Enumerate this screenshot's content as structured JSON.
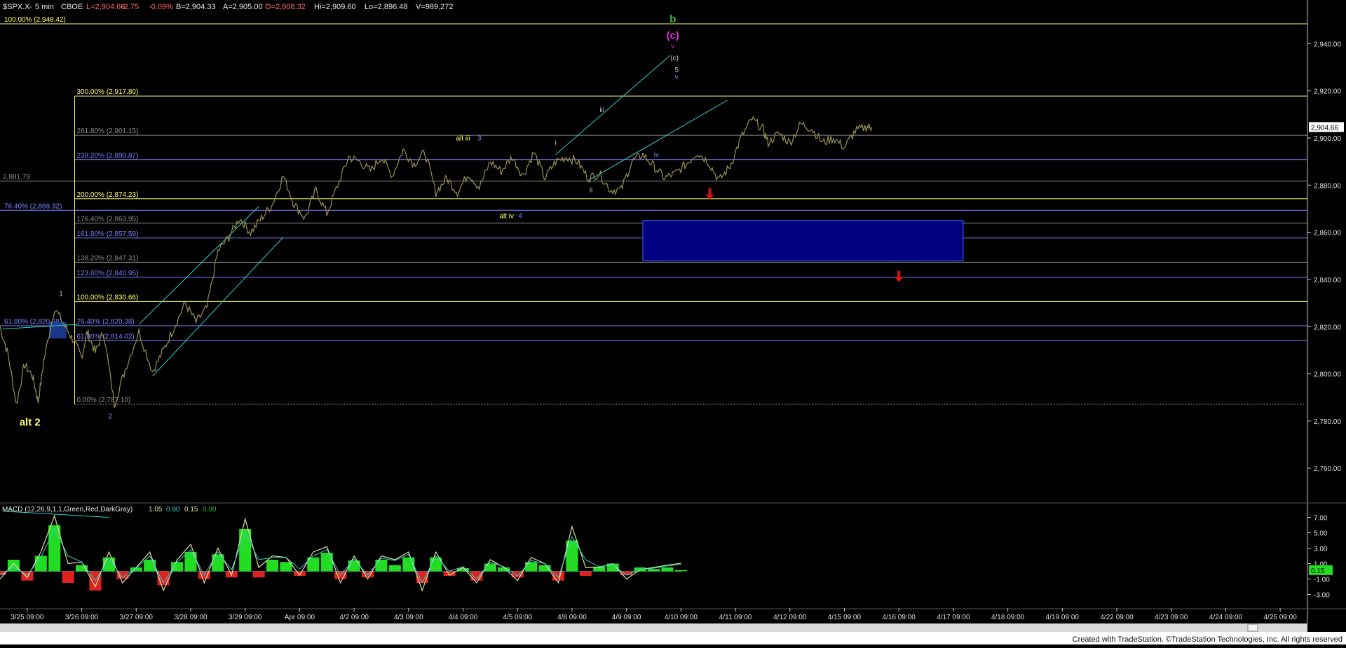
{
  "header": {
    "symbol": "$SPX.X",
    "interval": "5 min",
    "exchange": "CBOE",
    "last": "L=2,904.66",
    "change": "-2.75",
    "change_pct": "-0.09%",
    "bid": "B=2,904.33",
    "ask": "A=2,905.00",
    "open": "O=2,908.32",
    "high": "Hi=2,909.60",
    "low": "Lo=2,896.48",
    "volume": "V=989,272"
  },
  "colors": {
    "background": "#000000",
    "axis": "#c8c8c8",
    "yellow": "#ffff66",
    "blue": "#7f7fff",
    "gray": "#8a8a8a",
    "cyan": "#33cccc",
    "green_label": "#2fbf2f",
    "magenta": "#dd33dd",
    "target_box": "#000080",
    "arrow_red": "#dd1111",
    "macd_green": "#22dd22",
    "macd_red": "#dd2222",
    "macd_line": "#e0e0a0",
    "macd_signal": "#33cccc"
  },
  "footer": {
    "credit": "Created with TradeStation. ©TradeStation Technologies, Inc. All rights reserved"
  },
  "macd_header": {
    "label": "MACD (12,26,9,1,1,Green,Red,DarkGray)",
    "v1": "1.05",
    "v2": "0.90",
    "v3": "0.15",
    "v4": "0.00"
  },
  "chart_data": [
    {
      "type": "line",
      "title": "$SPX.X - 5 min CBOE",
      "ylim": [
        2747,
        2952
      ],
      "x_tick_labels": [
        "3/25 09:00",
        "3/26 09:00",
        "3/27 09:00",
        "3/28 09:00",
        "3/29 09:00",
        "Apr 09:00",
        "4/2 09:00",
        "4/3 09:00",
        "4/4 09:00",
        "4/5 09:00",
        "4/8 09:00",
        "4/9 09:00",
        "4/10 09:00",
        "4/11 09:00",
        "4/12 09:00",
        "4/15 09:00",
        "4/16 09:00",
        "4/17 09:00",
        "4/18 09:00",
        "4/19 09:00",
        "4/22 09:00",
        "4/23 09:00",
        "4/24 09:00",
        "4/25 09:00"
      ],
      "x_tick_positions": [
        0.5,
        1.5,
        2.5,
        3.5,
        4.5,
        5.5,
        6.5,
        7.5,
        8.5,
        9.5,
        10.5,
        11.5,
        12.5,
        13.5,
        14.5,
        15.5,
        16.5,
        17.5,
        18.5,
        19.5,
        20.5,
        21.5,
        22.5,
        23.5
      ],
      "y_ticks": [
        2760,
        2780,
        2800,
        2820,
        2840,
        2860,
        2880,
        2900,
        2920,
        2940
      ],
      "y_tick_labels": [
        "2,760.00",
        "2,780.00",
        "2,800.00",
        "2,820.00",
        "2,840.00",
        "2,860.00",
        "2,880.00",
        "2,900.00",
        "2,920.00",
        "2,940.00"
      ],
      "last_price_label": "2,904.66",
      "last_price": 2904.66,
      "series": [
        {
          "values_x": [
            0,
            0.15,
            0.3,
            0.45,
            0.6,
            0.7,
            0.8,
            1.0,
            1.2,
            1.35,
            1.5,
            1.6,
            1.75,
            1.9,
            2.1,
            2.3,
            2.55,
            2.8,
            3.0,
            3.2,
            3.4,
            3.6,
            3.8,
            4.0,
            4.2,
            4.4,
            4.6,
            4.8,
            5.0,
            5.2,
            5.4,
            5.6,
            5.8,
            6.0,
            6.2,
            6.4,
            6.6,
            6.8,
            7.0,
            7.2,
            7.4,
            7.6,
            7.8,
            8.0,
            8.2,
            8.4,
            8.6,
            8.8,
            9.0,
            9.2,
            9.4,
            9.6,
            9.8,
            10.0,
            10.2,
            10.4,
            10.6,
            10.8,
            11.0,
            11.2,
            11.4,
            11.6,
            11.8,
            12.0,
            12.2,
            12.4,
            12.6,
            12.8,
            13.0,
            13.2,
            13.4,
            13.6,
            13.8,
            14.0,
            14.1,
            14.3,
            14.5,
            14.7,
            14.9,
            15.1,
            15.3,
            15.5,
            15.7,
            15.9,
            16.0
          ],
          "values": [
            2820,
            2808,
            2787,
            2804,
            2799,
            2788,
            2805,
            2828,
            2820,
            2814,
            2807,
            2818,
            2809,
            2818,
            2787,
            2802,
            2818,
            2801,
            2810,
            2820,
            2830,
            2822,
            2828,
            2852,
            2858,
            2866,
            2860,
            2866,
            2872,
            2884,
            2872,
            2866,
            2878,
            2868,
            2880,
            2892,
            2890,
            2886,
            2892,
            2884,
            2895,
            2889,
            2894,
            2877,
            2883,
            2877,
            2885,
            2879,
            2890,
            2886,
            2892,
            2884,
            2894,
            2883,
            2890,
            2892,
            2890,
            2883,
            2885,
            2878,
            2878,
            2890,
            2893,
            2888,
            2883,
            2885,
            2889,
            2894,
            2890,
            2882,
            2888,
            2900,
            2908,
            2904,
            2898,
            2902,
            2898,
            2906,
            2904,
            2898,
            2900,
            2896,
            2903,
            2904.66,
            2904.66
          ]
        }
      ],
      "fib_levels": [
        {
          "label": "100.00% (2,948.42)",
          "value": 2948.42,
          "color": "yellow"
        },
        {
          "label": "300.00% (2,917.80)",
          "value": 2917.8,
          "color": "yellow"
        },
        {
          "label": "261.80% (2,901.15)",
          "value": 2901.15,
          "color": "gray"
        },
        {
          "label": "238.20% (2,890.87)",
          "value": 2890.87,
          "color": "blue"
        },
        {
          "label": "2,881.79",
          "value": 2881.79,
          "color": "gray"
        },
        {
          "label": "200.00% (2,874.23)",
          "value": 2874.23,
          "color": "yellow"
        },
        {
          "label": "76.40% (2,869.32)",
          "value": 2869.32,
          "color": "blue"
        },
        {
          "label": "176.40% (2,863.95)",
          "value": 2863.95,
          "color": "gray"
        },
        {
          "label": "161.80% (2,857.59)",
          "value": 2857.59,
          "color": "blue"
        },
        {
          "label": "138.20% (2,847.31)",
          "value": 2847.31,
          "color": "gray"
        },
        {
          "label": "123.60% (2,840.95)",
          "value": 2840.95,
          "color": "blue"
        },
        {
          "label": "100.00% (2,830.66)",
          "value": 2830.66,
          "color": "yellow"
        },
        {
          "label": "76.40% (2,820.38)",
          "value": 2820.38,
          "color": "blue"
        },
        {
          "label": "61.80% (2,820.38)",
          "value": 2820.38,
          "color": "blue"
        },
        {
          "label": "61.80% (2,814.02)",
          "value": 2814.02,
          "color": "blue"
        },
        {
          "label": "0.00% (2,787.10)",
          "value": 2787.1,
          "color": "gray"
        }
      ],
      "wave_labels": [
        {
          "text": "b",
          "x": 12.35,
          "y": 2949,
          "color": "green_label"
        },
        {
          "text": "(c)",
          "x": 12.35,
          "y": 2942,
          "color": "magenta"
        },
        {
          "text": "v",
          "x": 12.35,
          "y": 2938,
          "color": "magenta"
        },
        {
          "text": "(c)",
          "x": 12.38,
          "y": 2933,
          "color": "axis"
        },
        {
          "text": "5",
          "x": 12.42,
          "y": 2928,
          "color": "axis"
        },
        {
          "text": "v",
          "x": 12.42,
          "y": 2925,
          "color": "blue"
        },
        {
          "text": "iii",
          "x": 11.05,
          "y": 2911,
          "color": "axis"
        },
        {
          "text": "i",
          "x": 10.2,
          "y": 2897,
          "color": "axis"
        },
        {
          "text": "iv",
          "x": 12.05,
          "y": 2892,
          "color": "blue"
        },
        {
          "text": "ii",
          "x": 10.85,
          "y": 2877,
          "color": "axis"
        },
        {
          "text": "alt iii",
          "x": 8.5,
          "y": 2899,
          "color": "yellow"
        },
        {
          "text": "3",
          "x": 8.8,
          "y": 2899,
          "color": "blue"
        },
        {
          "text": "alt iv",
          "x": 9.3,
          "y": 2866,
          "color": "yellow"
        },
        {
          "text": "4",
          "x": 9.55,
          "y": 2866,
          "color": "blue"
        },
        {
          "text": "1",
          "x": 1.12,
          "y": 2833,
          "color": "axis"
        },
        {
          "text": "2",
          "x": 2.02,
          "y": 2781,
          "color": "blue"
        },
        {
          "text": "alt 2",
          "x": 0.55,
          "y": 2778,
          "color": "yellow"
        }
      ],
      "channels": [
        {
          "x1": 2.55,
          "y1": 2821,
          "x2": 4.75,
          "y2": 2871
        },
        {
          "x1": 2.8,
          "y1": 2799,
          "x2": 5.2,
          "y2": 2858
        },
        {
          "x1": 10.2,
          "y1": 2893,
          "x2": 12.3,
          "y2": 2935
        },
        {
          "x1": 10.8,
          "y1": 2882,
          "x2": 13.35,
          "y2": 2916
        },
        {
          "x1": 0.05,
          "y1": 2819,
          "x2": 1.45,
          "y2": 2821
        }
      ],
      "target_box": {
        "x1": 11.8,
        "x2": 17.68,
        "y1": 2848,
        "y2": 2865
      },
      "small_box": {
        "x1": 0.9,
        "x2": 1.22,
        "y1": 2815,
        "y2": 2822
      },
      "arrows": [
        {
          "x": 13.03,
          "y": 2876
        },
        {
          "x": 16.5,
          "y": 2841
        }
      ]
    },
    {
      "type": "area",
      "title": "MACD (12,26,9,1,1,Green,Red,DarkGray)",
      "ylim": [
        -4.5,
        8.5
      ],
      "y_ticks": [
        -3,
        -1,
        1,
        3,
        5,
        7
      ],
      "y_tick_labels": [
        "-3.00",
        "-1.00",
        "1.00",
        "3.00",
        "5.00",
        "7.00"
      ],
      "current_label": "0.15",
      "current_value": 0.15,
      "x": [
        0,
        0.25,
        0.5,
        0.75,
        1.0,
        1.25,
        1.5,
        1.75,
        2.0,
        2.25,
        2.5,
        2.75,
        3.0,
        3.25,
        3.5,
        3.75,
        4.0,
        4.25,
        4.5,
        4.75,
        5.0,
        5.25,
        5.5,
        5.75,
        6.0,
        6.25,
        6.5,
        6.75,
        7.0,
        7.25,
        7.5,
        7.75,
        8.0,
        8.25,
        8.5,
        8.75,
        9.0,
        9.25,
        9.5,
        9.75,
        10.0,
        10.25,
        10.5,
        10.75,
        11.0,
        11.25,
        11.5,
        11.75,
        12.0,
        12.25,
        12.5
      ],
      "histogram": [
        -0.5,
        1.5,
        -1.2,
        2.0,
        6.0,
        -1.5,
        0.8,
        -2.5,
        1.8,
        -1.0,
        0.5,
        1.5,
        -1.8,
        1.2,
        2.5,
        -1.0,
        2.2,
        -0.8,
        5.5,
        -0.8,
        1.5,
        1.2,
        -0.6,
        1.8,
        2.4,
        -1.0,
        1.4,
        -0.8,
        1.5,
        0.8,
        1.8,
        -1.5,
        1.8,
        -0.6,
        0.4,
        -1.2,
        1.0,
        0.5,
        -0.8,
        1.2,
        0.8,
        -1.2,
        4.0,
        -0.6,
        0.6,
        1.0,
        -0.5,
        0.5,
        0.3,
        0.5,
        0.15
      ],
      "macd": [
        -1.0,
        1.0,
        -0.8,
        2.5,
        7.2,
        1.0,
        1.2,
        -2.0,
        2.5,
        -1.5,
        0.5,
        2.5,
        -2.5,
        1.5,
        3.5,
        -1.5,
        3.0,
        -0.5,
        6.8,
        0.5,
        2.0,
        1.8,
        -0.5,
        2.5,
        3.2,
        -1.5,
        2.0,
        -1.0,
        2.0,
        1.5,
        2.5,
        -2.5,
        2.5,
        -0.5,
        0.5,
        -1.5,
        1.5,
        0.5,
        -1.2,
        1.8,
        1.0,
        -1.5,
        5.8,
        0.5,
        0.5,
        1.0,
        -1.0,
        0.2,
        0.5,
        0.8,
        1.05
      ],
      "signal": [
        -0.5,
        0.6,
        -0.5,
        1.8,
        5.5,
        2.0,
        1.2,
        -1.2,
        1.6,
        -0.8,
        0.4,
        2.0,
        -1.5,
        1.2,
        2.8,
        -0.5,
        2.5,
        0.2,
        5.0,
        1.5,
        1.8,
        1.8,
        0.3,
        2.0,
        2.8,
        -0.5,
        1.6,
        -0.5,
        1.7,
        1.4,
        2.2,
        -1.5,
        2.0,
        0.0,
        0.6,
        -1.0,
        1.2,
        0.6,
        -0.6,
        1.4,
        1.0,
        -0.8,
        4.5,
        1.5,
        0.6,
        0.9,
        -0.5,
        0.2,
        0.4,
        0.7,
        0.9
      ]
    }
  ]
}
